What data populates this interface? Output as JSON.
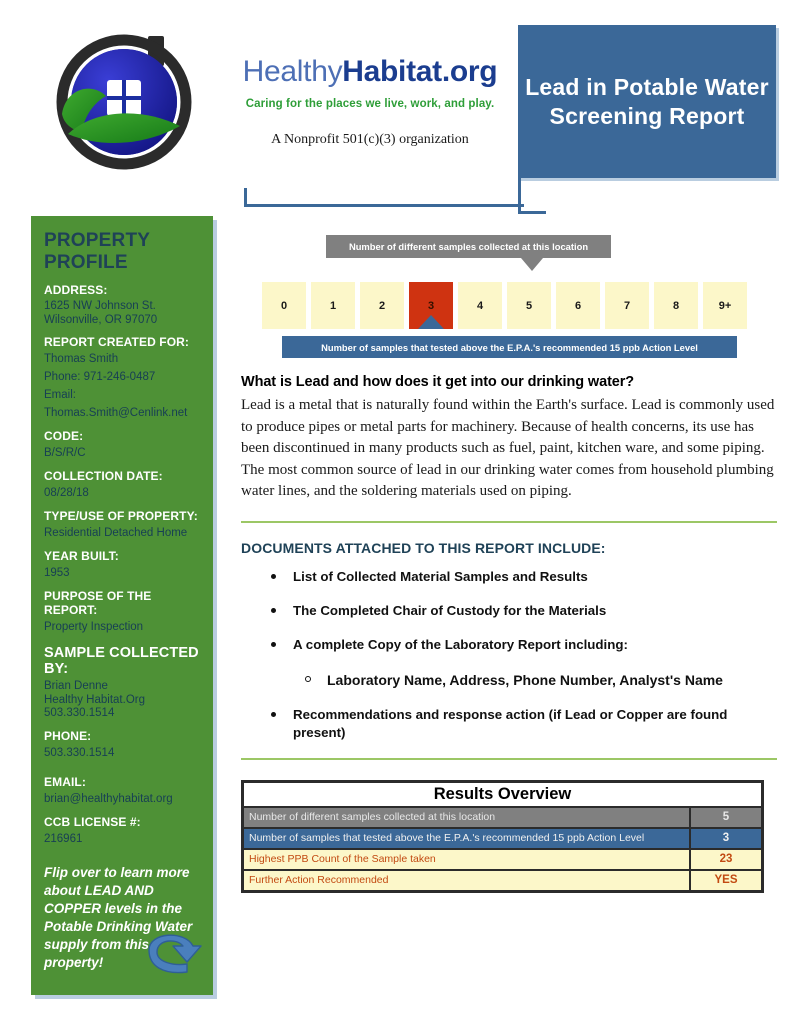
{
  "header": {
    "brand_first": "Healthy",
    "brand_second": "Habitat.org",
    "tagline": "Caring for the places we live, work, and play.",
    "nonprofit": "A Nonprofit 501(c)(3) organization",
    "report_title": "Lead in Potable Water Screening Report"
  },
  "sidebar": {
    "title": "PROPERTY PROFILE",
    "fields": [
      {
        "label": "ADDRESS:",
        "value": "1625 NW Johnson St.\nWilsonville, OR 97070"
      },
      {
        "label": "REPORT CREATED FOR:",
        "value": "Thomas Smith"
      },
      {
        "label": "",
        "value": "Phone: 971-246-0487"
      },
      {
        "label": "",
        "value": "Email:"
      },
      {
        "label": "",
        "value": "Thomas.Smith@Cenlink.net"
      },
      {
        "label": "CODE:",
        "value": "B/S/R/C"
      },
      {
        "label": "COLLECTION DATE:",
        "value": "08/28/18"
      },
      {
        "label": "TYPE/USE OF PROPERTY:",
        "value": "Residential Detached Home"
      },
      {
        "label": "YEAR BUILT:",
        "value": "1953"
      },
      {
        "label": "PURPOSE OF THE REPORT:",
        "value": "Property Inspection"
      },
      {
        "label": "SAMPLE COLLECTED BY:",
        "value": "Brian Denne\nHealthy Habitat.Org\n503.330.1514"
      },
      {
        "label": "PHONE:",
        "value": "503.330.1514"
      },
      {
        "label": "EMAIL:",
        "value": "brian@healthyhabitat.org"
      },
      {
        "label": "CCB LICENSE #:",
        "value": "216961"
      }
    ],
    "address_label": "ADDRESS:",
    "address_value": "1625 NW Johnson St.\nWilsonville, OR 97070",
    "created_for_label": "REPORT CREATED FOR:",
    "created_for_name": "Thomas Smith",
    "created_for_phone": "Phone: 971-246-0487",
    "created_for_email_label": "Email:",
    "created_for_email": "Thomas.Smith@Cenlink.net",
    "code_label": "CODE:",
    "code_value": "B/S/R/C",
    "collection_label": "COLLECTION DATE:",
    "collection_value": "08/28/18",
    "type_label": "TYPE/USE OF PROPERTY:",
    "type_value": "Residential Detached Home",
    "year_label": "YEAR BUILT:",
    "year_value": "1953",
    "purpose_label": "PURPOSE OF THE REPORT:",
    "purpose_value": "Property Inspection",
    "collected_by_label": "SAMPLE COLLECTED BY:",
    "collected_by_value": "Brian Denne\nHealthy Habitat.Org\n503.330.1514",
    "phone_label": "PHONE:",
    "phone_value": "503.330.1514",
    "email_label": "EMAIL:",
    "email_value": "brian@healthyhabitat.org",
    "ccb_label": "CCB LICENSE #:",
    "ccb_value": "216961",
    "flip_note": "Flip over to learn more about LEAD AND COPPER levels in the Potable Drinking Water supply from this property!"
  },
  "scale": {
    "gray_callout": "Number of different samples collected at this location",
    "blue_callout": "Number of samples that tested above the E.P.A.'s recommended 15 ppb Action Level",
    "cells": [
      "0",
      "1",
      "2",
      "3",
      "4",
      "5",
      "6",
      "7",
      "8",
      "9+"
    ],
    "active_index": 3,
    "gray_pointer_index": 5,
    "active_color": "#cf3311",
    "cell_color": "#fcf7c9",
    "gray_color": "#808080",
    "blue_color": "#3b6898"
  },
  "main": {
    "question_heading": "What is Lead and how does it get into our drinking water?",
    "question_body": "Lead is a metal that is naturally found within the Earth's surface.  Lead is commonly used to produce pipes or metal parts for machinery.  Because of health concerns, its use has been discontinued in many products such as fuel, paint, kitchen ware, and some piping.  The most common source of lead in our drinking water comes from household plumbing water lines, and the soldering materials used on piping.",
    "docs_heading": "DOCUMENTS ATTACHED TO THIS REPORT INCLUDE:",
    "docs": [
      "List of Collected Material Samples and Results",
      "The Completed Chair of Custody for the Materials",
      "A complete Copy of the Laboratory Report including:",
      "Laboratory Name, Address, Phone Number, Analyst's Name",
      "Recommendations and response action (if Lead or Copper are found present)"
    ]
  },
  "chart_data": {
    "type": "table",
    "title": "Results Overview",
    "rows": [
      {
        "label": "Number of different samples collected at this location",
        "value": "5",
        "style": "gray"
      },
      {
        "label": "Number of samples that tested above the E.P.A.'s recommended 15 ppb Action Level",
        "value": "3",
        "style": "blue"
      },
      {
        "label": "Highest PPB Count of the Sample taken",
        "value": "23",
        "style": "yellow"
      },
      {
        "label": "Further Action Recommended",
        "value": "YES",
        "style": "yellow"
      }
    ]
  }
}
